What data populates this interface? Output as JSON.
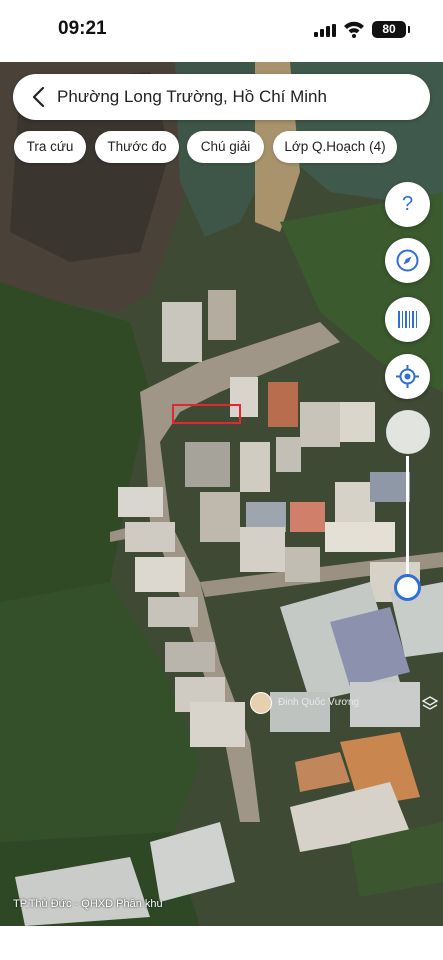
{
  "status_bar": {
    "time": "09:21",
    "battery": "80"
  },
  "search": {
    "location": "Phường Long Trường, Hồ Chí Minh",
    "back_icon": "chevron-left-icon"
  },
  "chips": [
    {
      "label": "Tra cứu"
    },
    {
      "label": "Thước đo"
    },
    {
      "label": "Chú giải"
    },
    {
      "label": "Lớp Q.Hoạch (4)"
    }
  ],
  "controls": {
    "help_label": "?",
    "compass_icon": "compass-icon",
    "barcode_icon": "barcode-icon",
    "locate_icon": "locate-icon",
    "accent_color": "#2f6fd8"
  },
  "map": {
    "user_name": "Đinh Quốc Vương",
    "source_label": "TP.Thủ Đức - QHXD Phân khu",
    "marker_color": "#e0282e"
  }
}
